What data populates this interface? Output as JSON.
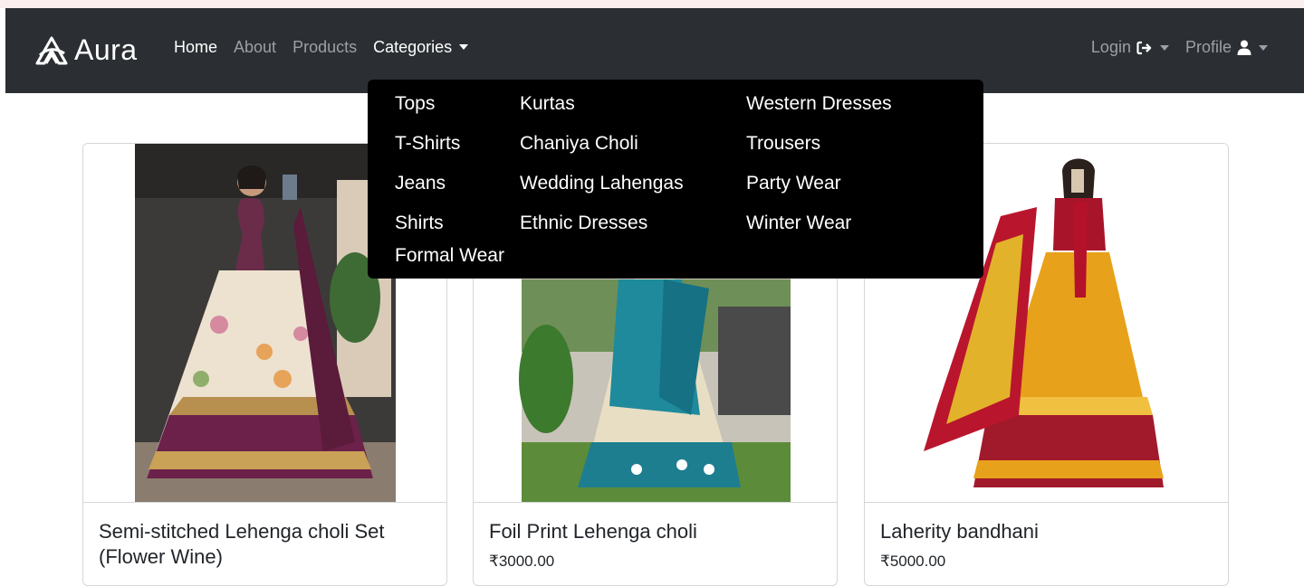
{
  "brand": {
    "name": "Aura"
  },
  "nav": {
    "links": [
      "Home",
      "About",
      "Products",
      "Categories"
    ],
    "right": {
      "login": "Login",
      "profile": "Profile"
    }
  },
  "categories": {
    "items": [
      "Tops",
      "T-Shirts",
      "Jeans",
      "Shirts",
      "Formal Wear",
      "Kurtas",
      "Chaniya Choli",
      "Wedding Lahengas",
      "Ethnic Dresses",
      "Western Dresses",
      "Trousers",
      "Party Wear",
      "Winter Wear"
    ]
  },
  "products": [
    {
      "title": "Semi-stitched Lehenga choli Set (Flower Wine)",
      "price": ""
    },
    {
      "title": "Foil Print Lehenga choli",
      "price": "₹3000.00"
    },
    {
      "title": "Laherity bandhani",
      "price": "₹5000.00"
    }
  ],
  "colors": {
    "navbar": "#2b2f33",
    "dropdown": "#000000",
    "link_muted": "#9aa0a6"
  }
}
